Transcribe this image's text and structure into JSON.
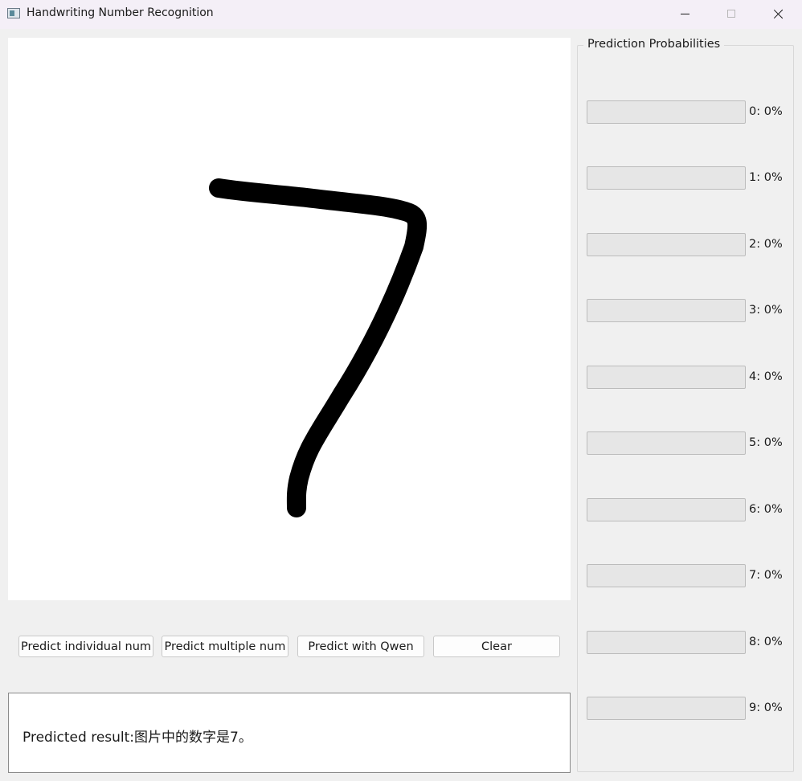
{
  "window": {
    "title": "Handwriting Number Recognition",
    "icon": "app-window-icon"
  },
  "buttons": {
    "predict_individual": "Predict individual num",
    "predict_multiple": "Predict multiple num",
    "predict_qwen": "Predict with Qwen",
    "clear": "Clear"
  },
  "result": {
    "text": "Predicted result:图片中的数字是7。"
  },
  "probabilities": {
    "title": "Prediction Probabilities",
    "fill_color": "#06b025",
    "items": [
      {
        "digit": "0",
        "label": "0: 0%",
        "value": 0
      },
      {
        "digit": "1",
        "label": "1: 0%",
        "value": 0
      },
      {
        "digit": "2",
        "label": "2: 0%",
        "value": 0
      },
      {
        "digit": "3",
        "label": "3: 0%",
        "value": 0
      },
      {
        "digit": "4",
        "label": "4: 0%",
        "value": 0
      },
      {
        "digit": "5",
        "label": "5: 0%",
        "value": 0
      },
      {
        "digit": "6",
        "label": "6: 0%",
        "value": 0
      },
      {
        "digit": "7",
        "label": "7: 0%",
        "value": 0
      },
      {
        "digit": "8",
        "label": "8: 0%",
        "value": 0
      },
      {
        "digit": "9",
        "label": "9: 0%",
        "value": 0
      }
    ]
  },
  "canvas": {
    "background": "#ffffff",
    "stroke_color": "#000000",
    "drawn_digit": "7"
  }
}
